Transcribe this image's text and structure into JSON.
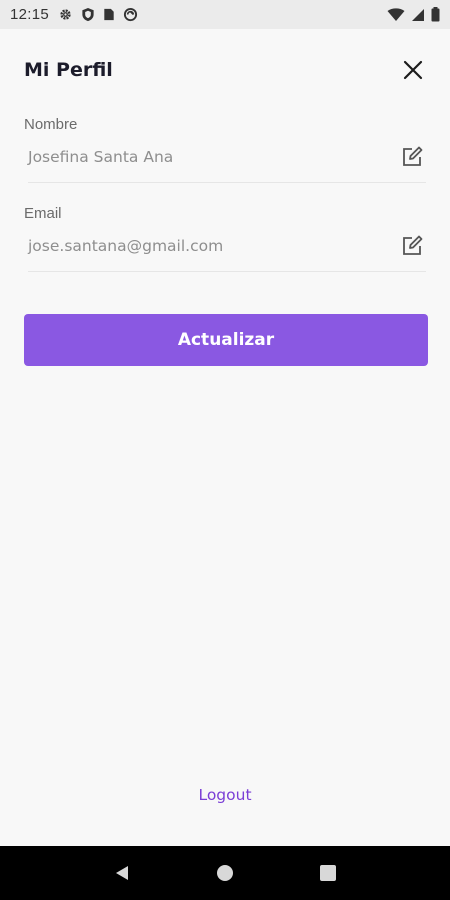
{
  "status_bar": {
    "time": "12:15",
    "left_icons": [
      "gear-icon",
      "shield-icon",
      "sim-card-icon",
      "sync-icon"
    ],
    "right_icons": [
      "wifi-icon",
      "signal-icon",
      "battery-icon"
    ]
  },
  "header": {
    "title": "Mi Perfil",
    "close_icon": "close-icon"
  },
  "fields": {
    "name": {
      "label": "Nombre",
      "value": "Josefina Santa Ana",
      "icon": "edit-icon"
    },
    "email": {
      "label": "Email",
      "value": "jose.santana@gmail.com",
      "icon": "edit-icon"
    }
  },
  "actions": {
    "update_label": "Actualizar",
    "logout_label": "Logout"
  },
  "colors": {
    "accent": "#8a58e2",
    "link": "#7b3fd6",
    "background": "#f8f8f8",
    "title": "#1c1c2b"
  },
  "nav_bar": {
    "buttons": [
      "back-icon",
      "home-icon",
      "recents-icon"
    ]
  }
}
